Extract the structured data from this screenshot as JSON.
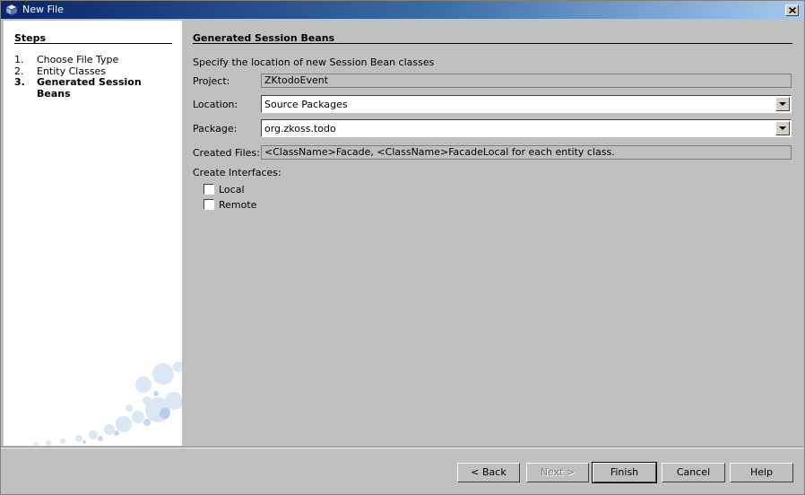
{
  "window": {
    "title": "New File",
    "close_icon": "close-icon"
  },
  "steps": {
    "title": "Steps",
    "items": [
      {
        "number": "1.",
        "label": "Choose File Type",
        "current": false
      },
      {
        "number": "2.",
        "label": "Entity Classes",
        "current": false
      },
      {
        "number": "3.",
        "label": "Generated Session Beans",
        "current": true
      }
    ]
  },
  "main": {
    "title": "Generated Session Beans",
    "description": "Specify the location of new Session Bean classes",
    "project": {
      "label": "Project:",
      "value": "ZKtodoEvent"
    },
    "location": {
      "label": "Location:",
      "value": "Source Packages"
    },
    "package": {
      "label": "Package:",
      "value": "org.zkoss.todo"
    },
    "created_files": {
      "label": "Created Files:",
      "value": "<ClassName>Facade, <ClassName>FacadeLocal for each entity class."
    },
    "interfaces": {
      "label": "Create Interfaces:",
      "local": {
        "label": "Local",
        "checked": false
      },
      "remote": {
        "label": "Remote",
        "checked": false
      }
    }
  },
  "buttons": {
    "back": "< Back",
    "next": "Next >",
    "finish": "Finish",
    "cancel": "Cancel",
    "help": "Help"
  }
}
